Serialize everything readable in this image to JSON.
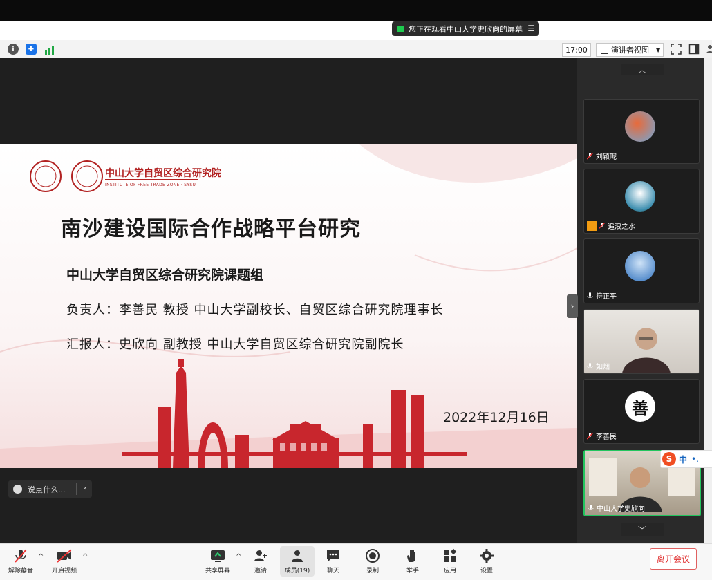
{
  "share_banner": {
    "text": "您正在观看中山大学史欣向的屏幕",
    "menu_icon": "list-icon"
  },
  "toolbar": {
    "time": "17:00",
    "view_mode": "演讲者视图",
    "icons": [
      "info-icon",
      "shield-icon",
      "signal-icon",
      "fullscreen-icon",
      "panel-icon"
    ]
  },
  "slide": {
    "logo_cn": "中山大学自贸区综合研究院",
    "logo_en": "INSTITUTE OF FREE TRADE ZONE · SYSU",
    "title": "南沙建设国际合作战略平台研究",
    "group": "中山大学自贸区综合研究院课题组",
    "lead": "负责人：李善民  教授  中山大学副校长、自贸区综合研究院理事长",
    "reporter": "汇报人：史欣向  副教授  中山大学自贸区综合研究院副院长",
    "date": "2022年12月16日"
  },
  "chat": {
    "placeholder": "说点什么..."
  },
  "participants": [
    {
      "name": "刘颖昵",
      "muted": true
    },
    {
      "name": "追浪之水",
      "muted": true
    },
    {
      "name": "符正平",
      "muted": false
    },
    {
      "name": "如烟",
      "muted": false
    },
    {
      "name": "李善民",
      "muted": true,
      "avatar_char": "善"
    },
    {
      "name": "中山大学史欣向",
      "muted": false
    }
  ],
  "ime": {
    "label": "中"
  },
  "bottom": {
    "unmute": "解除静音",
    "start_video": "开启视频",
    "share_screen": "共享屏幕",
    "invite": "邀请",
    "members": "成员(19)",
    "chat": "聊天",
    "record": "录制",
    "raise_hand": "举手",
    "apps": "应用",
    "settings": "设置",
    "leave": "离开会议"
  },
  "colors": {
    "accent": "#1ecb4f",
    "slide_red": "#c8262d",
    "leave": "#e03030"
  }
}
